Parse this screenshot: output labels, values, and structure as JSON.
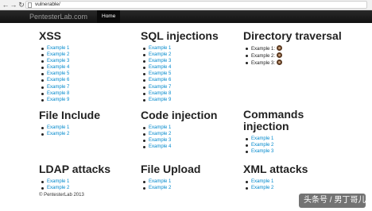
{
  "browser": {
    "url": "vulnerable/"
  },
  "navbar": {
    "brand": "PentesterLab.com",
    "home": "Home"
  },
  "sections": {
    "xss": {
      "title": "XSS",
      "items": [
        "Example 1",
        "Example 2",
        "Example 3",
        "Example 4",
        "Example 5",
        "Example 6",
        "Example 7",
        "Example 8",
        "Example 9"
      ]
    },
    "sqli": {
      "title": "SQL injections",
      "items": [
        "Example 1",
        "Example 2",
        "Example 3",
        "Example 4",
        "Example 5",
        "Example 6",
        "Example 7",
        "Example 8",
        "Example 9"
      ]
    },
    "dirtrav": {
      "title": "Directory traversal",
      "items": [
        "Example 1:",
        "Example 2:",
        "Example 3:"
      ]
    },
    "fileinc": {
      "title": "File Include",
      "items": [
        "Example 1",
        "Example 2"
      ]
    },
    "codeinj": {
      "title": "Code injection",
      "items": [
        "Example 1",
        "Example 2",
        "Example 3",
        "Example 4"
      ]
    },
    "cmdinj": {
      "title": "Commands injection",
      "items": [
        "Example 1",
        "Example 2",
        "Example 3"
      ]
    },
    "ldap": {
      "title": "LDAP attacks",
      "items": [
        "Example 1",
        "Example 2"
      ]
    },
    "upload": {
      "title": "File Upload",
      "items": [
        "Example 1",
        "Example 2"
      ]
    },
    "xml": {
      "title": "XML attacks",
      "items": [
        "Example 1",
        "Example 2"
      ]
    }
  },
  "footer": "© PentesterLab 2013",
  "watermark": "头条号 / 男丁哥儿",
  "colors": {
    "link": "#0088cc",
    "navbar": "#1b1b1b",
    "text": "#222222"
  }
}
